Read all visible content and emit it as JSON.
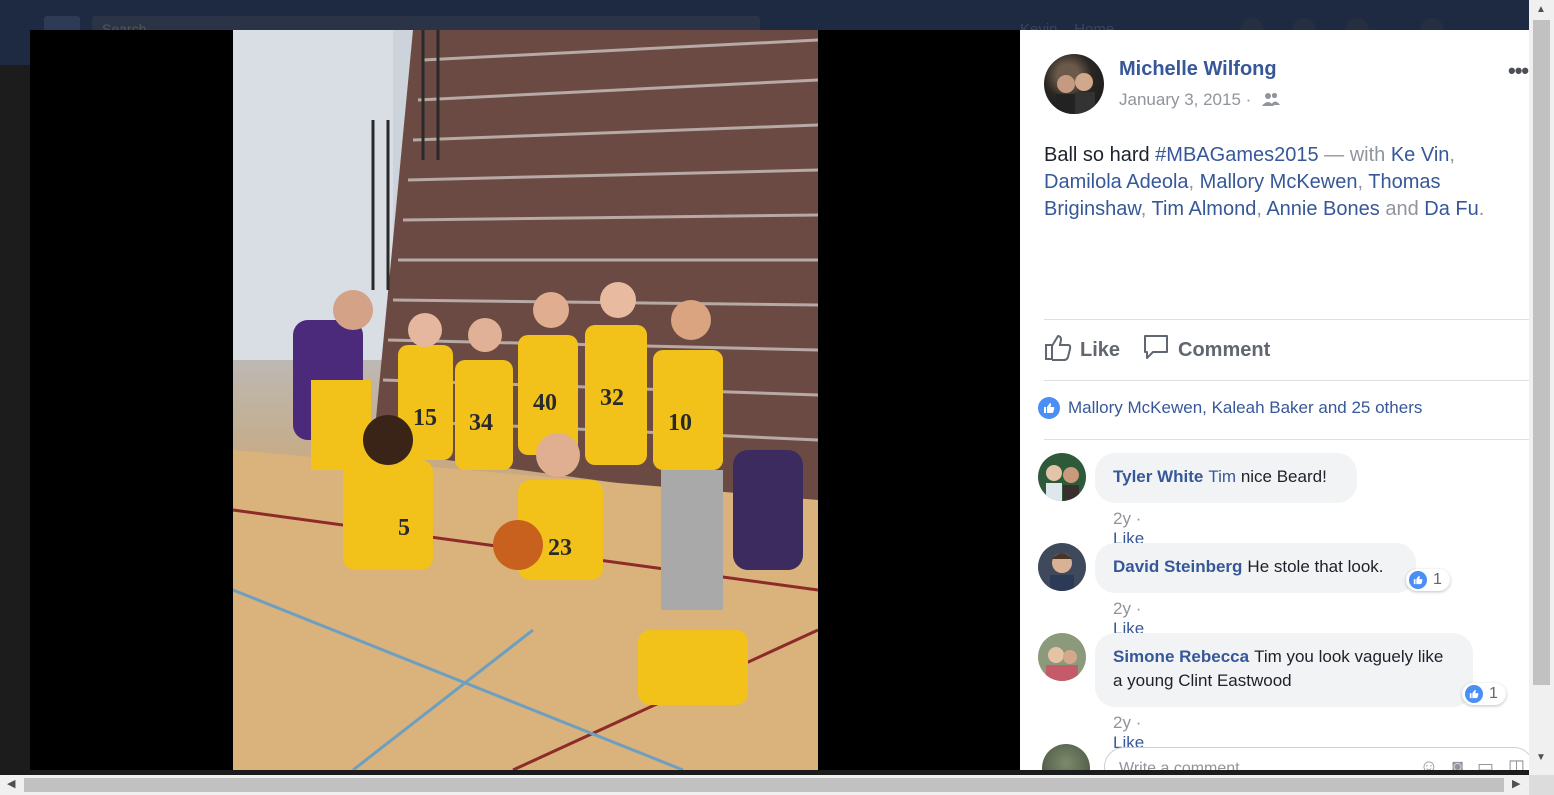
{
  "background": {
    "search_placeholder": "Search",
    "user_name": "Kevin",
    "home_label": "Home"
  },
  "post": {
    "author": "Michelle Wilfong",
    "date": "January 3, 2015 ·",
    "audience_icon": "friends-icon",
    "more_label": "•••",
    "text": {
      "lead": "Ball so hard ",
      "hashtag": "#MBAGames2015",
      "with": " — with ",
      "tags": [
        "Ke Vin",
        "Damilola Adeola",
        "Mallory McKewen",
        "Thomas Briginshaw",
        "Tim Almond",
        "Annie Bones",
        "Da Fu"
      ],
      "sep": ", ",
      "and": " and ",
      "end": "."
    }
  },
  "actions": {
    "like_label": "Like",
    "comment_label": "Comment"
  },
  "reactions": {
    "summary": "Mallory McKewen, Kaleah Baker and 25 others"
  },
  "comments": [
    {
      "name": "Tyler White",
      "tag": "Tim",
      "text": "nice Beard!",
      "time": "2y",
      "like_label": "Like",
      "reactions": null
    },
    {
      "name": "David Steinberg",
      "tag": "",
      "text": "He stole that look.",
      "time": "2y",
      "like_label": "Like",
      "reactions": "1"
    },
    {
      "name": "Simone Rebecca",
      "tag": "",
      "text": "Tim you look vaguely like a young Clint Eastwood",
      "time": "2y",
      "like_label": "Like",
      "reactions": "1"
    }
  ],
  "write_comment": {
    "placeholder": "Write a comment..."
  },
  "colors": {
    "link": "#365899",
    "muted": "#90949c",
    "like_blue": "#4b8ef6",
    "jersey_gold": "#f2c21b",
    "jersey_purple": "#4b2a7b"
  }
}
